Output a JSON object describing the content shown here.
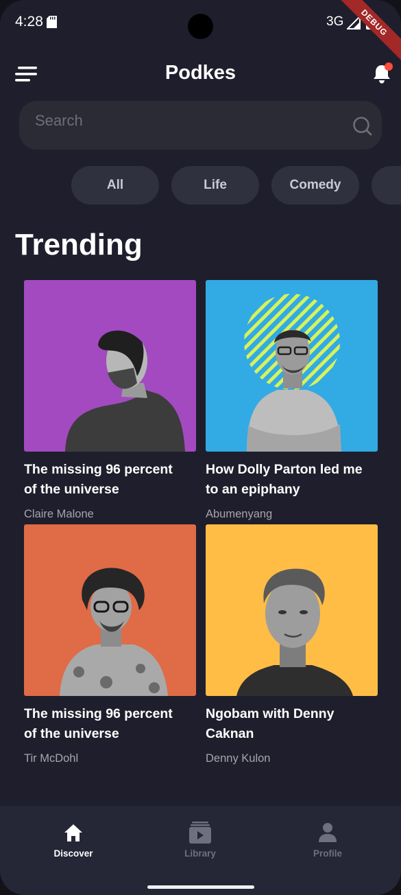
{
  "status_bar": {
    "time": "4:28",
    "network": "3G",
    "debug_label": "DEBUG"
  },
  "app_bar": {
    "title": "Podkes"
  },
  "search": {
    "placeholder": "Search"
  },
  "categories": [
    "All",
    "Life",
    "Comedy"
  ],
  "section_title": "Trending",
  "trending": [
    {
      "title": "The missing 96 percent of the universe",
      "author": "Claire Malone",
      "bg_color": "#a34ac0"
    },
    {
      "title": "How Dolly Parton led me to an epiphany",
      "author": "Abumenyang",
      "bg_color": "#32aae4"
    },
    {
      "title": "The missing 96 percent of the universe",
      "author": "Tir McDohl",
      "bg_color": "#e06b47"
    },
    {
      "title": "Ngobam with Denny Caknan",
      "author": "Denny Kulon",
      "bg_color": "#ffbd46"
    }
  ],
  "bottom_nav": [
    {
      "label": "Discover",
      "icon": "home-icon",
      "active": true
    },
    {
      "label": "Library",
      "icon": "library-icon",
      "active": false
    },
    {
      "label": "Profile",
      "icon": "profile-icon",
      "active": false
    }
  ],
  "colors": {
    "background": "#1f1e2c",
    "surface": "#2a2b35",
    "chip": "#30313f",
    "nav_active": "#ffffff",
    "nav_inactive": "#6e7080",
    "notification_dot": "#ff4d3a"
  }
}
